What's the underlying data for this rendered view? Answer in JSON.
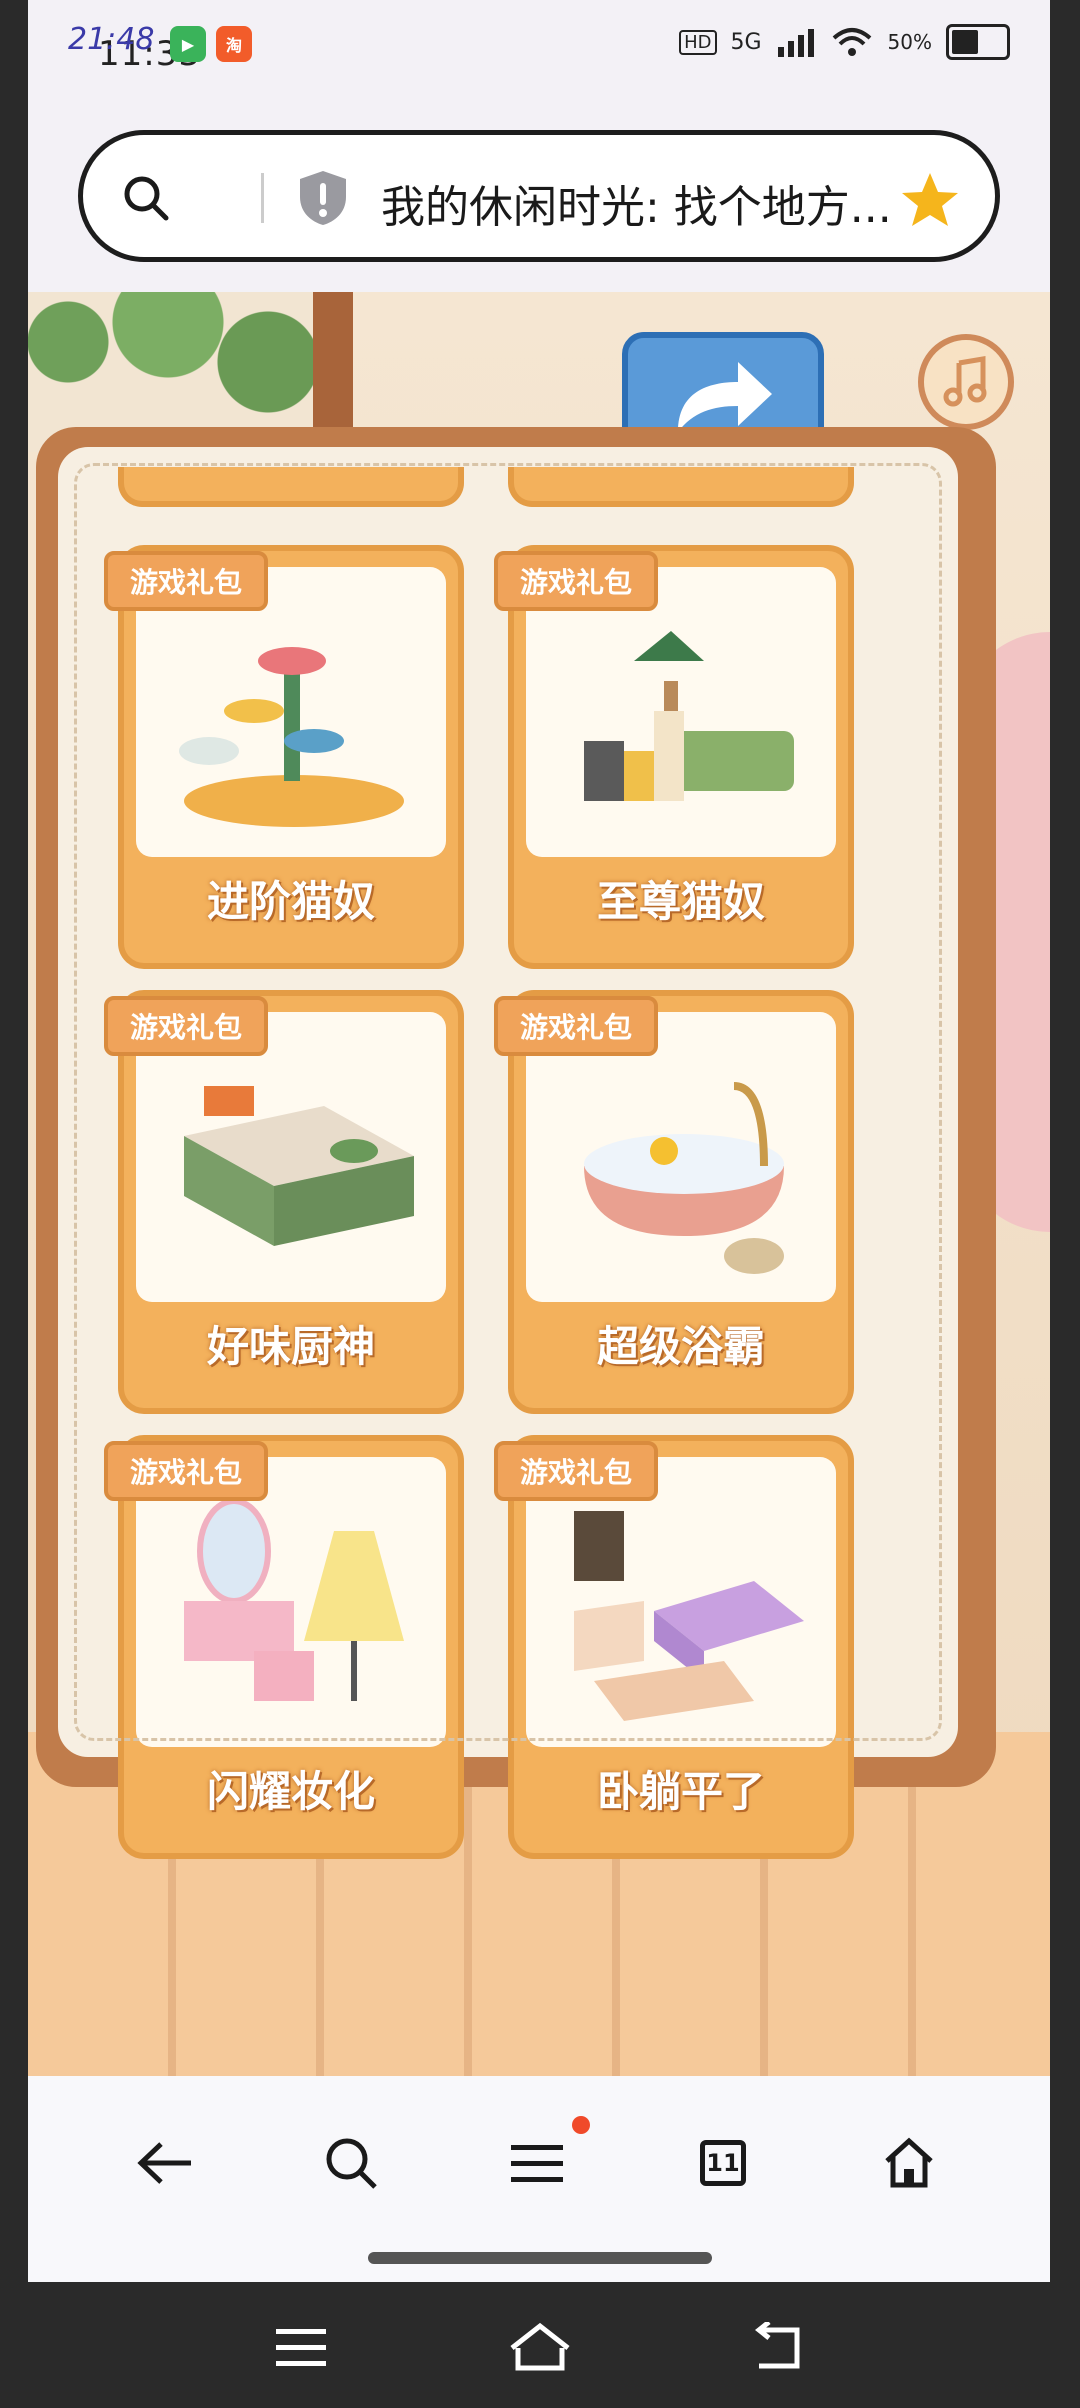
{
  "status_bar": {
    "time": "11:33",
    "time_overlay": "21:48",
    "network": "5G",
    "hd_label": "HD",
    "battery": "50%"
  },
  "search_bar": {
    "page_title": "我的休闲时光: 找个地方..."
  },
  "gift_tag": "游戏礼包",
  "gifts": [
    {
      "label": "进阶猫奴"
    },
    {
      "label": "至尊猫奴"
    },
    {
      "label": "好味厨神"
    },
    {
      "label": "超级浴霸"
    },
    {
      "label": "闪耀妆化"
    },
    {
      "label": "卧躺平了"
    }
  ],
  "bottom_nav": {
    "tab_count": "11"
  },
  "colors": {
    "card_orange": "#f3b15c",
    "tag_orange": "#f0a35a",
    "book_brown": "#c07c4b",
    "share_blue": "#5a9ad8",
    "notification_red": "#f04a2a"
  }
}
